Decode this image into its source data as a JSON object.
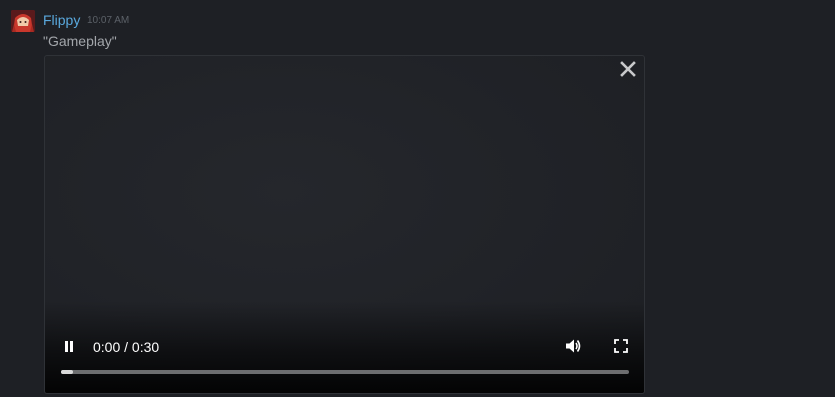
{
  "message": {
    "username": "Flippy",
    "timestamp": "10:07 AM",
    "text": "\"Gameplay\"",
    "username_color": "#5aa9de"
  },
  "video": {
    "current_time": "0:00",
    "duration": "0:30",
    "time_text": "0:00 / 0:30",
    "progress_fraction": 0.022,
    "state": "playing",
    "icons": {
      "close": "close-icon",
      "pause": "pause-icon",
      "volume": "volume-icon",
      "fullscreen": "fullscreen-icon"
    }
  }
}
